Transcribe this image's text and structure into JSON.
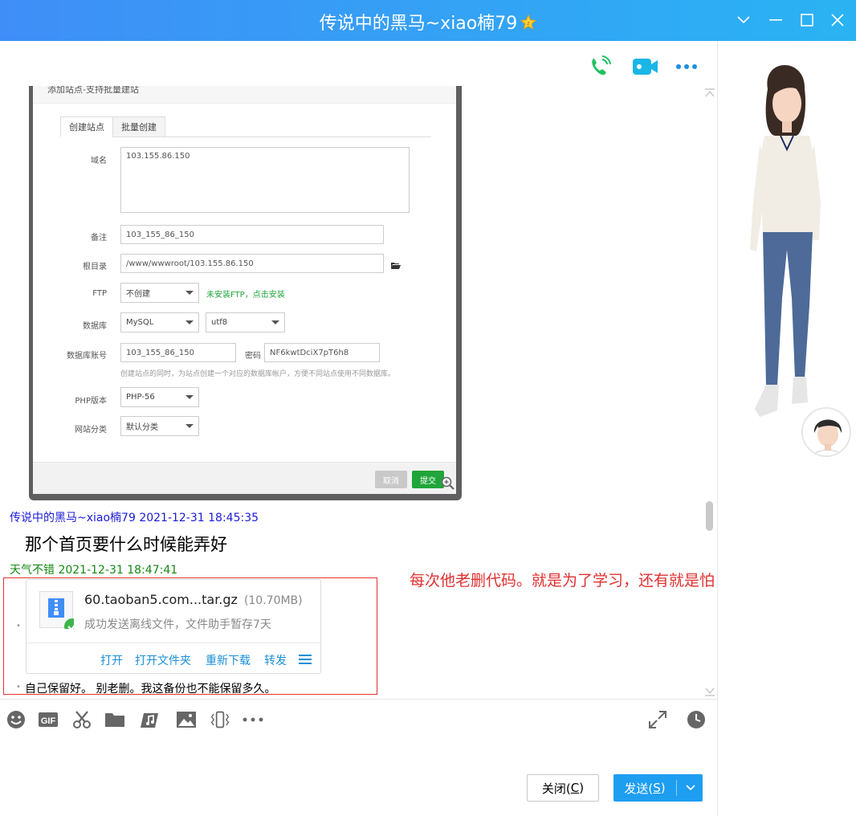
{
  "window": {
    "title": "传说中的黑马~xiao楠79"
  },
  "topbar_icons": [
    "phone-icon",
    "video-icon",
    "more-icon"
  ],
  "screenshot": {
    "header": "添加站点-支持批量建站",
    "tabs": [
      "创建站点",
      "批量创建"
    ],
    "labels": {
      "domain": "域名",
      "remark": "备注",
      "root": "根目录",
      "ftp": "FTP",
      "database": "数据库",
      "db_account": "数据库账号",
      "password": "密码",
      "php": "PHP版本",
      "category": "网站分类"
    },
    "values": {
      "domain": "103.155.86.150",
      "remark": "103_155_86_150",
      "root": "/www/wwwroot/103.155.86.150",
      "ftp": "不创建",
      "ftp_note": "未安装FTP，点击安装",
      "database": "MySQL",
      "charset": "utf8",
      "db_account": "103_155_86_150",
      "password": "NF6kwtDciX7pT6h8",
      "db_hint": "创建站点的同时，为站点创建一个对应的数据库帐户，方便不同站点使用不同数据库。",
      "php": "PHP-56",
      "category": "默认分类"
    },
    "buttons": {
      "cancel": "取消",
      "submit": "提交"
    }
  },
  "messages": {
    "m1_sender": "传说中的黑马~xiao楠79 2021-12-31 18:45:35",
    "m1_text": "那个首页要什么时候能弄好",
    "m2_sender": "天气不错 2021-12-31 18:47:41",
    "file": {
      "name": "60.taoban5.com...tar.gz",
      "size": "(10.70MB)",
      "status": "成功发送离线文件，文件助手暂存7天",
      "actions": [
        "打开",
        "打开文件夹",
        "重新下载",
        "转发"
      ]
    },
    "m2_text": "自己保留好。 别老删。我这备份也不能保留多久。"
  },
  "annotation": "每次他老删代码。就是为了学习，还有就是怕自己拿不到代码。",
  "toolbar_icons": [
    "emoji-icon",
    "gif-icon",
    "scissors-icon",
    "folder-icon",
    "music-icon",
    "image-icon",
    "shake-icon",
    "more-icon",
    "expand-icon",
    "history-icon"
  ],
  "buttons": {
    "close_prefix": "关闭(",
    "close_key": "C",
    "close_suffix": ")",
    "send_prefix": "发送(",
    "send_key": "S",
    "send_suffix": ")"
  },
  "colors": {
    "title_gradient_start": "#3f8ef7",
    "title_gradient_end": "#2ab3f3",
    "sender_blue": "#1a1ad6",
    "sender_green": "#138a13",
    "annotation_red": "#e03030",
    "link_blue": "#1b8fd6",
    "send_button": "#1e9ef0"
  }
}
